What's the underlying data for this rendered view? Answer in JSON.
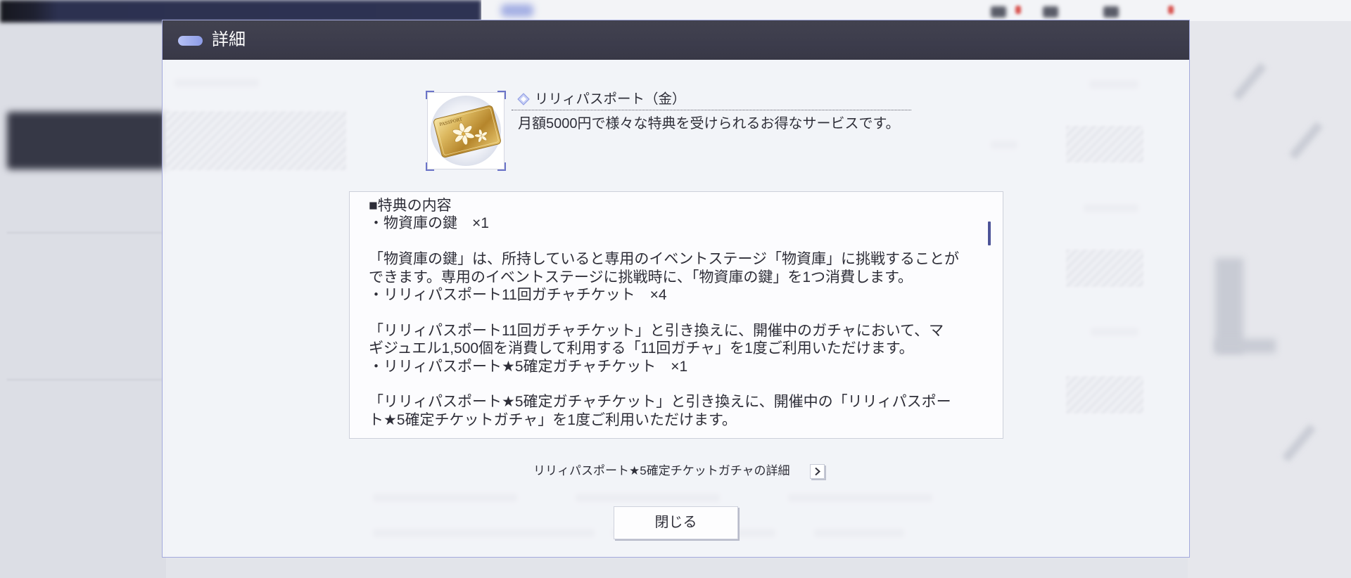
{
  "colors": {
    "header_background": "#3c3c4c",
    "accent": "#8c9be6",
    "dialog_border": "#a3a9dd",
    "scrollbar": "#4d5498",
    "text": "#30303a"
  },
  "dialog": {
    "title": "詳細",
    "title_icon": "pill-icon",
    "item": {
      "icon": "gold-passport-card-icon",
      "card_lettering": "PASSPORT",
      "name_icon": "diamond-icon",
      "name": "リリィパスポート（金）",
      "description": "月額5000円で様々な特典を受けられるお得なサービスです。"
    },
    "details": {
      "heading": "■特典の内容",
      "benefits": [
        {
          "item": "・物資庫の鍵　×1",
          "description": [
            "「物資庫の鍵」は、所持していると専用のイベントステージ「物資庫」に挑戦することが",
            "できます。専用のイベントステージに挑戦時に、「物資庫の鍵」を1つ消費します。"
          ]
        },
        {
          "item": "・リリィパスポート11回ガチャチケット　×4",
          "description": [
            "「リリィパスポート11回ガチャチケット」と引き換えに、開催中のガチャにおいて、マ",
            "ギジュエル1,500個を消費して利用する「11回ガチャ」を1度ご利用いただけます。"
          ]
        },
        {
          "item": "・リリィパスポート★5確定ガチャチケット　×1",
          "description": [
            "「リリィパスポート★5確定ガチャチケット」と引き換えに、開催中の「リリィパスポー",
            "ト★5確定チケットガチャ」を1度ご利用いただけます。"
          ]
        }
      ]
    },
    "link": {
      "label": "リリィパスポート★5確定チケットガチャの詳細",
      "icon": "chevron-right-icon"
    },
    "close_label": "閉じる"
  }
}
